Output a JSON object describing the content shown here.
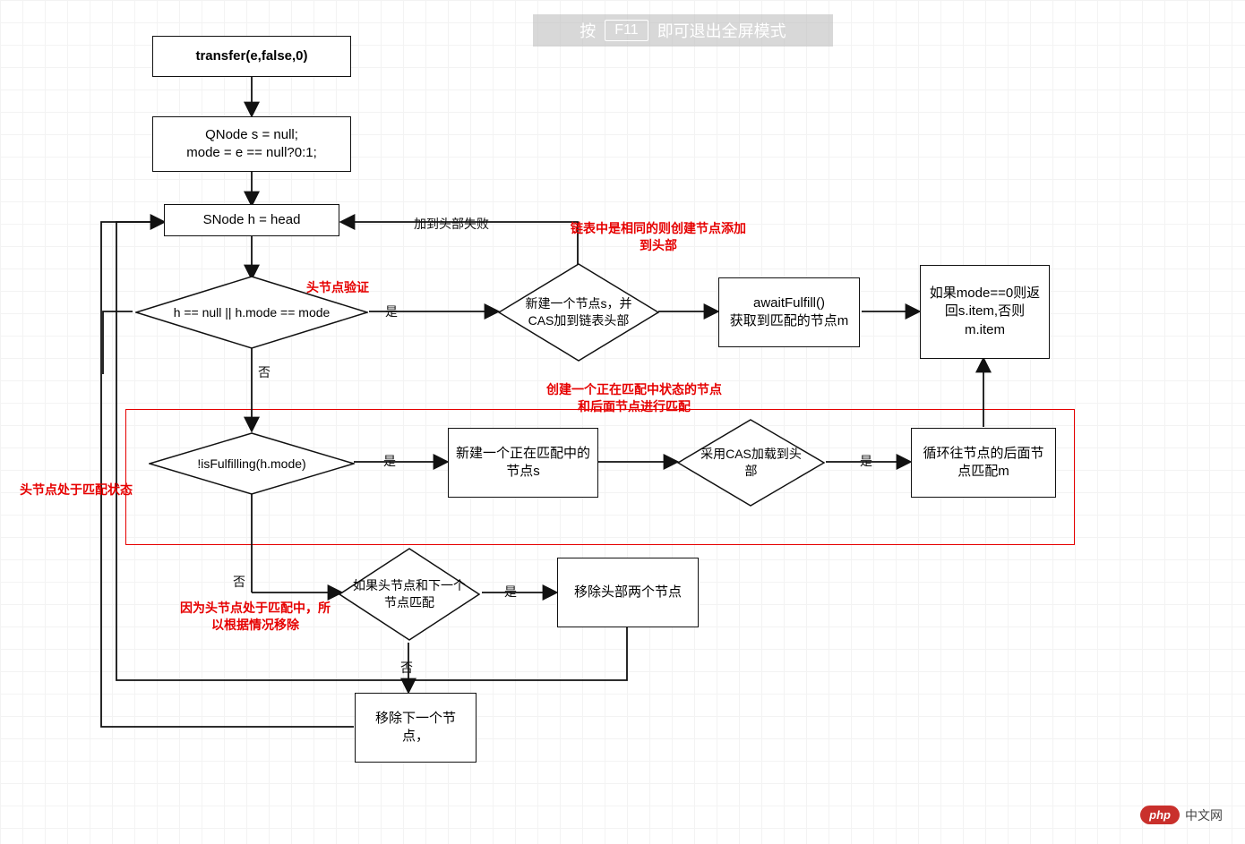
{
  "fullscreen_tip": {
    "prefix": "按",
    "key": "F11",
    "suffix": "即可退出全屏模式"
  },
  "nodes": {
    "start": "transfer(e,false,0)",
    "init": "QNode s = null;\nmode = e == null?0:1;",
    "head": "SNode h = head",
    "newNode": "新建一个节点s，并CAS加到链表头部",
    "await": "awaitFulfill()\n获取到匹配的节点m",
    "return": "如果mode==0则返回s.item,否则m.item",
    "newFulfill": "新建一个正在匹配中的节点s",
    "casHead": "采用CAS加载到头部",
    "loopMatch": "循环往节点的后面节点匹配m",
    "removeTwo": "移除头部两个节点",
    "removeNext": "移除下一个节点，"
  },
  "diamonds": {
    "cond1": "h == null || h.mode == mode",
    "cond2": "!isFulfilling(h.mode)",
    "cond3": "如果头节点和下一个节点匹配"
  },
  "edgeLabels": {
    "yes": "是",
    "no": "否",
    "addHeadFail": "加到头部失败"
  },
  "annotations": {
    "a1": "链表中是相同的则创建节点添加到头部",
    "a2": "头节点验证",
    "a3": "创建一个正在匹配中状态的节点和后面节点进行匹配",
    "a4": "头节点处于匹配状态",
    "a5": "因为头节点处于匹配中，所以根据情况移除"
  },
  "logo": {
    "badge": "php",
    "text": "中文网"
  }
}
